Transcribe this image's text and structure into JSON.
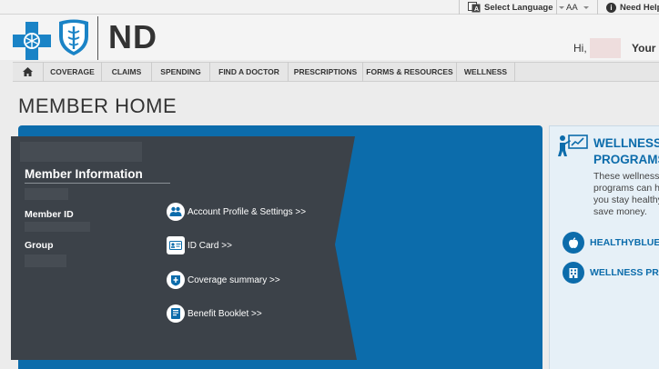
{
  "topbar": {
    "language_label": "Select Language",
    "text_size_label": "AA",
    "help_label": "Need Help"
  },
  "header": {
    "state_code": "ND",
    "greeting": "Hi,",
    "your_label": "Your"
  },
  "nav": {
    "items": [
      {
        "label": "COVERAGE"
      },
      {
        "label": "CLAIMS"
      },
      {
        "label": "SPENDING"
      },
      {
        "label": "FIND A DOCTOR"
      },
      {
        "label": "PRESCRIPTIONS"
      },
      {
        "label": "FORMS & RESOURCES"
      },
      {
        "label": "WELLNESS"
      }
    ]
  },
  "page": {
    "title": "MEMBER HOME"
  },
  "member_info": {
    "title": "Member Information",
    "member_id_label": "Member ID",
    "group_label": "Group"
  },
  "quick_links": [
    {
      "label": "Account Profile & Settings >>",
      "icon": "people-icon"
    },
    {
      "label": "ID Card >>",
      "icon": "id-card-icon"
    },
    {
      "label": "Coverage summary >>",
      "icon": "coverage-icon"
    },
    {
      "label": "Benefit Booklet >>",
      "icon": "booklet-icon"
    }
  ],
  "wellness": {
    "title": "WELLNESS PROGRAMS",
    "description": "These wellness programs can help you stay healthy and save money.",
    "links": [
      {
        "label": "HEALTHYBLUE HUB",
        "icon": "apple-icon"
      },
      {
        "label": "WELLNESS PROGRAMS",
        "icon": "building-icon"
      }
    ]
  },
  "colors": {
    "primary_blue": "#0c6cab",
    "dark_panel": "#3c4249",
    "page_background": "#ececec"
  }
}
